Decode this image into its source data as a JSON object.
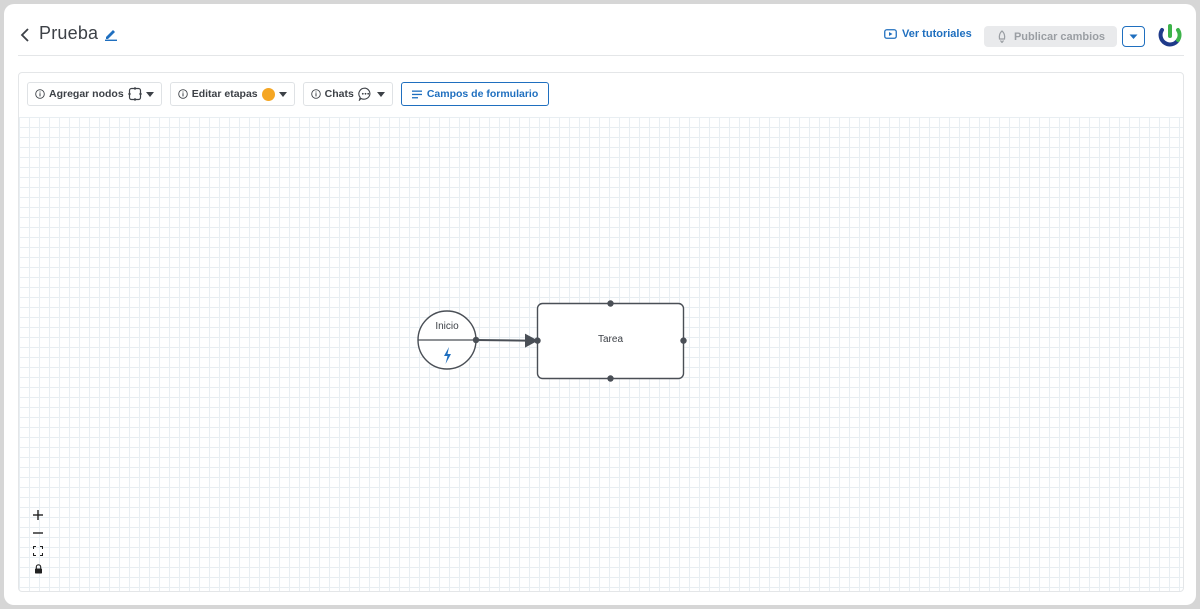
{
  "header": {
    "title": "Prueba",
    "tutorials_label": "Ver tutoriales",
    "publish_label": "Publicar cambios"
  },
  "toolbar": {
    "add_nodes_label": "Agregar nodos",
    "edit_stages_label": "Editar etapas",
    "chats_label": "Chats",
    "form_fields_label": "Campos de formulario"
  },
  "diagram": {
    "start_node_label": "Inicio",
    "task_node_label": "Tarea"
  },
  "icons": {
    "back": "chevron-left-icon",
    "edit": "pencil-icon",
    "tutorials": "youtube-icon",
    "publish": "rocket-icon",
    "dropdown": "chevron-down-icon",
    "info": "info-icon",
    "nodes": "node-square-icon",
    "stage": "stage-dot-icon",
    "chat": "chat-bubble-icon",
    "form": "list-icon",
    "trigger": "lightning-icon",
    "zoom_in": "plus-icon",
    "zoom_out": "minus-icon",
    "fit": "fit-view-icon",
    "lock": "lock-icon"
  },
  "colors": {
    "accent": "#1f6fbf",
    "stage_dot": "#f5a623",
    "node_stroke": "#4a4f56"
  }
}
